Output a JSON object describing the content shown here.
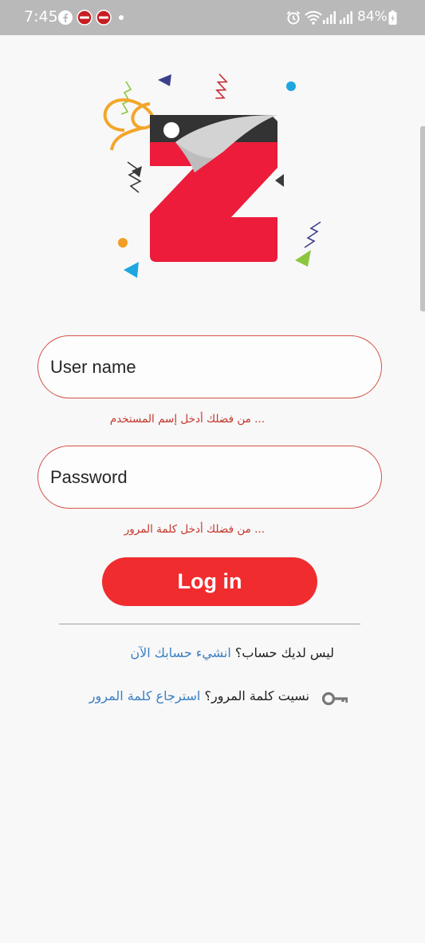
{
  "status_bar": {
    "time": "7:45",
    "battery": "84%",
    "icons": [
      "facebook-icon",
      "notification-app-icon",
      "notification-app-icon",
      "dot-icon",
      "alarm-icon",
      "wifi-icon",
      "signal-icon",
      "signal-icon",
      "battery-charging-icon"
    ]
  },
  "logo": {
    "icon": "z-tag-logo"
  },
  "login_form": {
    "username": {
      "placeholder": "User name",
      "value": "",
      "error": "... من فضلك أدخل إسم المستخدم"
    },
    "password": {
      "placeholder": "Password",
      "value": "",
      "error": "... من فضلك أدخل كلمة المرور"
    },
    "login_label": "Log in"
  },
  "signup_row": {
    "question": "ليس لديك حساب؟",
    "link": "انشيء حسابك الآن"
  },
  "forgot_row": {
    "question": "نسيت كلمة المرور؟",
    "link": "استرجاع كلمة المرور",
    "icon": "key-icon"
  },
  "colors": {
    "accent": "#f02c2f",
    "field_border": "#d45348",
    "link": "#3a7fc4",
    "error": "#c4342a"
  }
}
